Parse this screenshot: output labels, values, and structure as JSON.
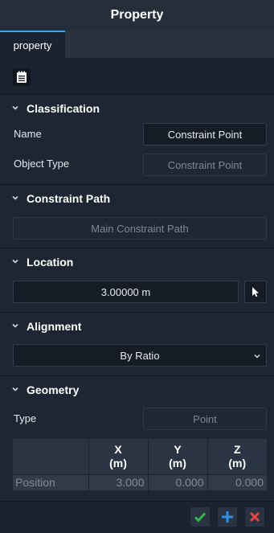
{
  "window": {
    "title": "Property"
  },
  "tabs": [
    {
      "label": "property"
    }
  ],
  "toolbar": {
    "icon": "document-list-icon"
  },
  "classification": {
    "title": "Classification",
    "name_label": "Name",
    "name_value": "Constraint Point",
    "object_type_label": "Object Type",
    "object_type_value": "Constraint Point"
  },
  "constraint_path": {
    "title": "Constraint Path",
    "value": "Main Constraint Path"
  },
  "location": {
    "title": "Location",
    "value": "3.00000 m"
  },
  "alignment": {
    "title": "Alignment",
    "selected": "By Ratio"
  },
  "geometry": {
    "title": "Geometry",
    "type_label": "Type",
    "type_value": "Point",
    "columns": [
      {
        "line1": "X",
        "line2": "(m)"
      },
      {
        "line1": "Y",
        "line2": "(m)"
      },
      {
        "line1": "Z",
        "line2": "(m)"
      }
    ],
    "rows": [
      {
        "label": "Position",
        "values": [
          "3.000",
          "0.000",
          "0.000"
        ]
      }
    ]
  },
  "colors": {
    "accent": "#3fa4e8",
    "confirm": "#2e9b3f",
    "add": "#2d7fd3",
    "cancel": "#d23b3b"
  }
}
